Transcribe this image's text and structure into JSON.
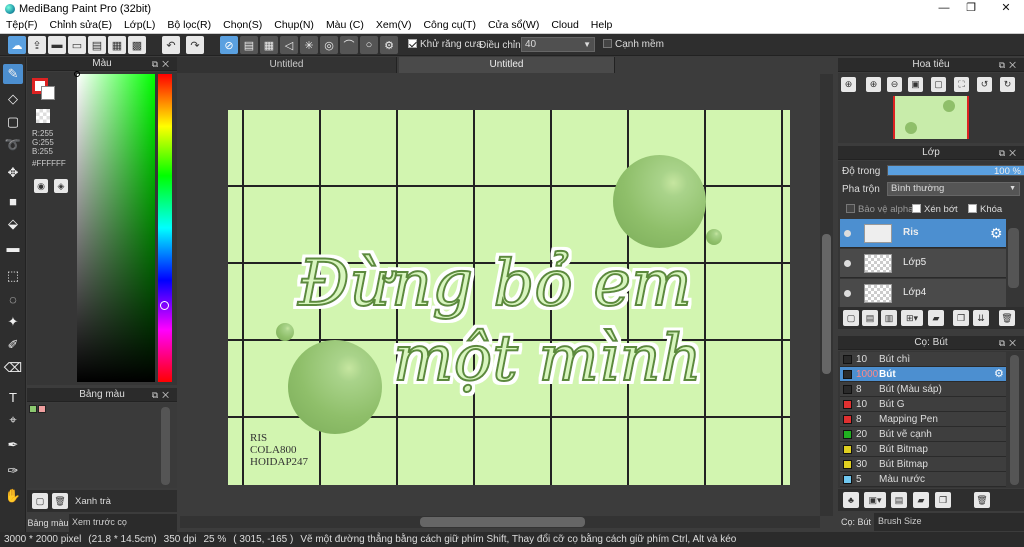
{
  "app": {
    "title": "MediBang Paint Pro (32bit)",
    "window_controls": [
      "—",
      "❐",
      "✕"
    ]
  },
  "menu": [
    "Tệp(F)",
    "Chỉnh sửa(E)",
    "Lớp(L)",
    "Bộ lọc(R)",
    "Chọn(S)",
    "Chụp(N)",
    "Màu (C)",
    "Xem(V)",
    "Công cụ(T)",
    "Cửa sổ(W)",
    "Cloud",
    "Help"
  ],
  "toolbar": {
    "antialias_label": "Khử răng cưa",
    "correction_label": "Điều chỉnh",
    "correction_value": "40",
    "soft_edge_label": "Cạnh mềm"
  },
  "color_panel": {
    "title": "Màu",
    "r": "R:255",
    "g": "G:255",
    "b": "B:255",
    "hex": "#FFFFFF"
  },
  "palette_panel": {
    "title": "Bảng màu",
    "palette_name": "Xanh trà",
    "tab_palette": "Bảng màu",
    "tab_brush_preview": "Xem trước cọ"
  },
  "tabs": [
    "Untitled",
    "Untitled"
  ],
  "artwork": {
    "line1": "Đừng bỏ em",
    "line2": "một mình",
    "sig_lines": [
      "RIS",
      "COLA800",
      "HOIDAP247"
    ]
  },
  "navigator_panel": {
    "title": "Hoa tiêu"
  },
  "layer_panel": {
    "title": "Lớp",
    "opacity_label": "Độ trong",
    "opacity_value": "100 %",
    "opacity_fraction": 1.0,
    "blend_label": "Pha trộn",
    "blend_value": "Bình thường",
    "protect_alpha_label": "Bảo vệ alpha",
    "clipping_label": "Xén bớt",
    "lock_label": "Khóa",
    "layers": [
      {
        "name": "Ris",
        "selected": true
      },
      {
        "name": "Lớp5",
        "selected": false
      },
      {
        "name": "Lớp4",
        "selected": false
      }
    ]
  },
  "brush_panel": {
    "title": "Cọ: Bút",
    "tab_brush": "Cọ: Bút",
    "tab_size": "Brush Size",
    "brushes": [
      {
        "size": "10",
        "name": "Bút chì",
        "color": "#2a2a2a",
        "selected": false
      },
      {
        "size": "1000",
        "name": "Bút",
        "color": "#2a2a2a",
        "selected": true
      },
      {
        "size": "8",
        "name": "Bút (Màu sáp)",
        "color": "#2a2a2a",
        "selected": false
      },
      {
        "size": "10",
        "name": "Bút G",
        "color": "#e03030",
        "selected": false
      },
      {
        "size": "8",
        "name": "Mapping Pen",
        "color": "#e03030",
        "selected": false
      },
      {
        "size": "20",
        "name": "Bút vẽ cạnh",
        "color": "#20b020",
        "selected": false
      },
      {
        "size": "50",
        "name": "Bút Bitmap",
        "color": "#e0d020",
        "selected": false
      },
      {
        "size": "30",
        "name": "Bút Bitmap",
        "color": "#e0d020",
        "selected": false
      },
      {
        "size": "5",
        "name": "Màu nước",
        "color": "#70c8f0",
        "selected": false
      }
    ]
  },
  "status": {
    "size": "3000 * 2000 pixel",
    "cm": "(21.8 * 14.5cm)",
    "dpi": "350 dpi",
    "zoom": "25 %",
    "coords": "( 3015, -165 )",
    "hint": "Vẽ một đường thẳng bằng cách giữ phím Shift, Thay đổi cỡ cọ bằng cách giữ phím Ctrl, Alt và kéo"
  }
}
